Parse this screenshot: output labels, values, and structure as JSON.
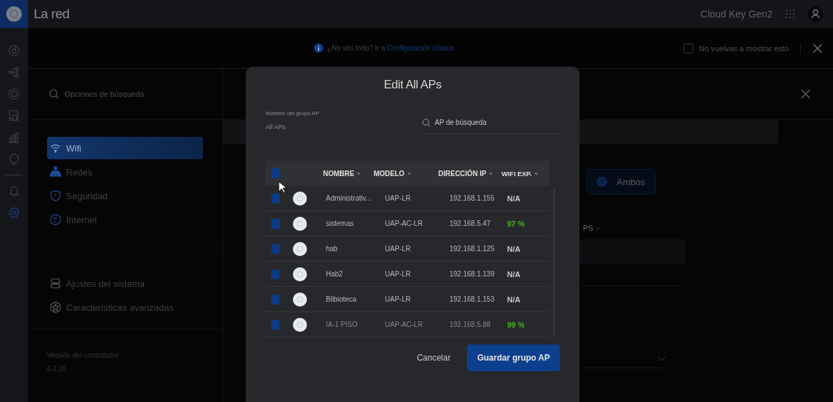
{
  "app_title": "La red",
  "header": {
    "device": "Cloud Key Gen2"
  },
  "rail": [
    {
      "selected": false
    },
    {
      "selected": false
    },
    {
      "selected": false
    },
    {
      "selected": false
    },
    {
      "selected": false
    },
    {
      "selected": false
    },
    {
      "selected": false
    },
    {
      "selected": true
    }
  ],
  "banner": {
    "text": "¿No ves todo? Ir a ",
    "link": "Configuración clásica",
    "dont_show": {
      "label": "No vuelvas a mostrar esto",
      "checked": false
    }
  },
  "sidebar": {
    "search": {
      "placeholder": "Opciones de búsqueda"
    },
    "groups": [
      [
        {
          "label": "Wifi",
          "selected": true
        },
        {
          "label": "Redes",
          "selected": false
        },
        {
          "label": "Seguridad",
          "selected": false
        },
        {
          "label": "Internet",
          "selected": false
        }
      ],
      [
        {
          "label": "Ajustes del sistema",
          "selected": false
        },
        {
          "label": "Características avanzadas",
          "selected": false
        }
      ]
    ],
    "version_label": "Versión del controlador",
    "version": "6.2.26"
  },
  "background": {
    "radio": {
      "label": "Ambos",
      "selected": true
    },
    "partial_label": "PS"
  },
  "modal": {
    "title": "Edit All APs",
    "group_name_label": "Nombre del grupo AP",
    "group_name": "All APs",
    "search": {
      "placeholder": "AP de búsqueda"
    },
    "columns": [
      "NOMBRE",
      "MODELO",
      "DIRECCIÓN IP",
      "WIFI EXP."
    ],
    "select_all": true,
    "rows": [
      {
        "checked": true,
        "name": "Administrativ...",
        "model": "UAP-LR",
        "ip": "192.168.1.155",
        "wifi": "N/A",
        "color": "#c8c8c8"
      },
      {
        "checked": true,
        "name": "sistemas",
        "model": "UAP-AC-LR",
        "ip": "192.168.5.47",
        "wifi": "97 %",
        "color": "#4caf2a"
      },
      {
        "checked": true,
        "name": "hab",
        "model": "UAP-LR",
        "ip": "192.168.1.125",
        "wifi": "N/A",
        "color": "#c8c8c8"
      },
      {
        "checked": true,
        "name": "Hab2",
        "model": "UAP-LR",
        "ip": "192.168.1.139",
        "wifi": "N/A",
        "color": "#c8c8c8"
      },
      {
        "checked": true,
        "name": "Blibioteca",
        "model": "UAP-LR",
        "ip": "192.168.1.153",
        "wifi": "N/A",
        "color": "#c8c8c8"
      },
      {
        "checked": true,
        "name": "IA-1 PISO",
        "model": "UAP-AC-LR",
        "ip": "192.168.5.88",
        "wifi": "99 %",
        "color": "#4caf2a"
      }
    ],
    "cancel": "Cancelar",
    "save": "Guardar grupo AP"
  }
}
